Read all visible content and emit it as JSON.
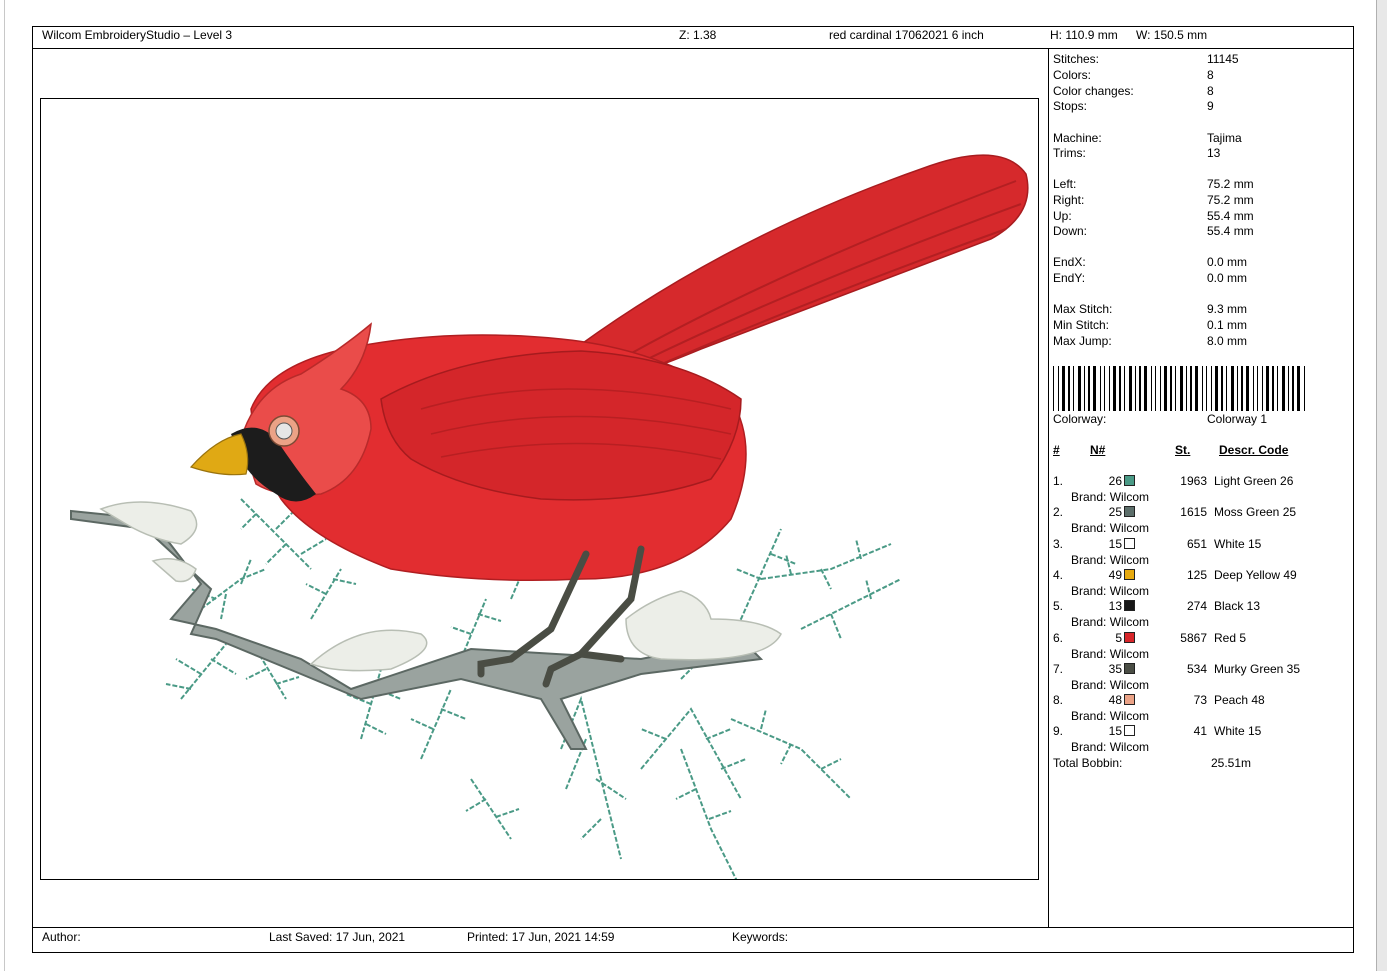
{
  "header": {
    "app_title": "Wilcom EmbroideryStudio – Level 3",
    "zoom": "Z: 1.38",
    "design_name": "red cardinal 17062021 6 inch",
    "height": "H: 110.9 mm",
    "width": "W: 150.5 mm"
  },
  "stats": {
    "stitches_label": "Stitches:",
    "stitches": "11145",
    "colors_label": "Colors:",
    "colors": "8",
    "color_changes_label": "Color changes:",
    "color_changes": "8",
    "stops_label": "Stops:",
    "stops": "9",
    "machine_label": "Machine:",
    "machine": "Tajima",
    "trims_label": "Trims:",
    "trims": "13",
    "left_label": "Left:",
    "left": "75.2 mm",
    "right_label": "Right:",
    "right": "75.2 mm",
    "up_label": "Up:",
    "up": "55.4 mm",
    "down_label": "Down:",
    "down": "55.4 mm",
    "endx_label": "EndX:",
    "endx": "0.0 mm",
    "endy_label": "EndY:",
    "endy": "0.0 mm",
    "max_stitch_label": "Max Stitch:",
    "max_stitch": "9.3 mm",
    "min_stitch_label": "Min Stitch:",
    "min_stitch": "0.1 mm",
    "max_jump_label": "Max Jump:",
    "max_jump": "8.0 mm",
    "colorway_label": "Colorway:",
    "colorway": "Colorway 1",
    "total_bobbin_label": "Total Bobbin:",
    "total_bobbin": "25.51m"
  },
  "color_table": {
    "headers": {
      "index": "#",
      "number": "N#",
      "stitches": "St.",
      "descr": "Descr. Code"
    },
    "brand_text": "Brand: Wilcom",
    "rows": [
      {
        "index": "1.",
        "number": "26",
        "stitches": "1963",
        "descr": "Light Green 26",
        "color": "#4a9a86"
      },
      {
        "index": "2.",
        "number": "25",
        "stitches": "1615",
        "descr": "Moss Green 25",
        "color": "#5c6e6a"
      },
      {
        "index": "3.",
        "number": "15",
        "stitches": "651",
        "descr": "White 15",
        "color": "#ffffff"
      },
      {
        "index": "4.",
        "number": "49",
        "stitches": "125",
        "descr": "Deep Yellow 49",
        "color": "#e6a90e"
      },
      {
        "index": "5.",
        "number": "13",
        "stitches": "274",
        "descr": "Black 13",
        "color": "#161616"
      },
      {
        "index": "6.",
        "number": "5",
        "stitches": "5867",
        "descr": "Red 5",
        "color": "#d8262a"
      },
      {
        "index": "7.",
        "number": "35",
        "stitches": "534",
        "descr": "Murky Green 35",
        "color": "#4a4d44"
      },
      {
        "index": "8.",
        "number": "48",
        "stitches": "73",
        "descr": "Peach 48",
        "color": "#eba286"
      },
      {
        "index": "9.",
        "number": "15",
        "stitches": "41",
        "descr": "White 15",
        "color": "#ffffff"
      }
    ]
  },
  "footer": {
    "author": "Author:",
    "last_saved": "Last Saved: 17 Jun, 2021",
    "printed": "Printed: 17 Jun, 2021 14:59",
    "keywords": "Keywords:"
  }
}
